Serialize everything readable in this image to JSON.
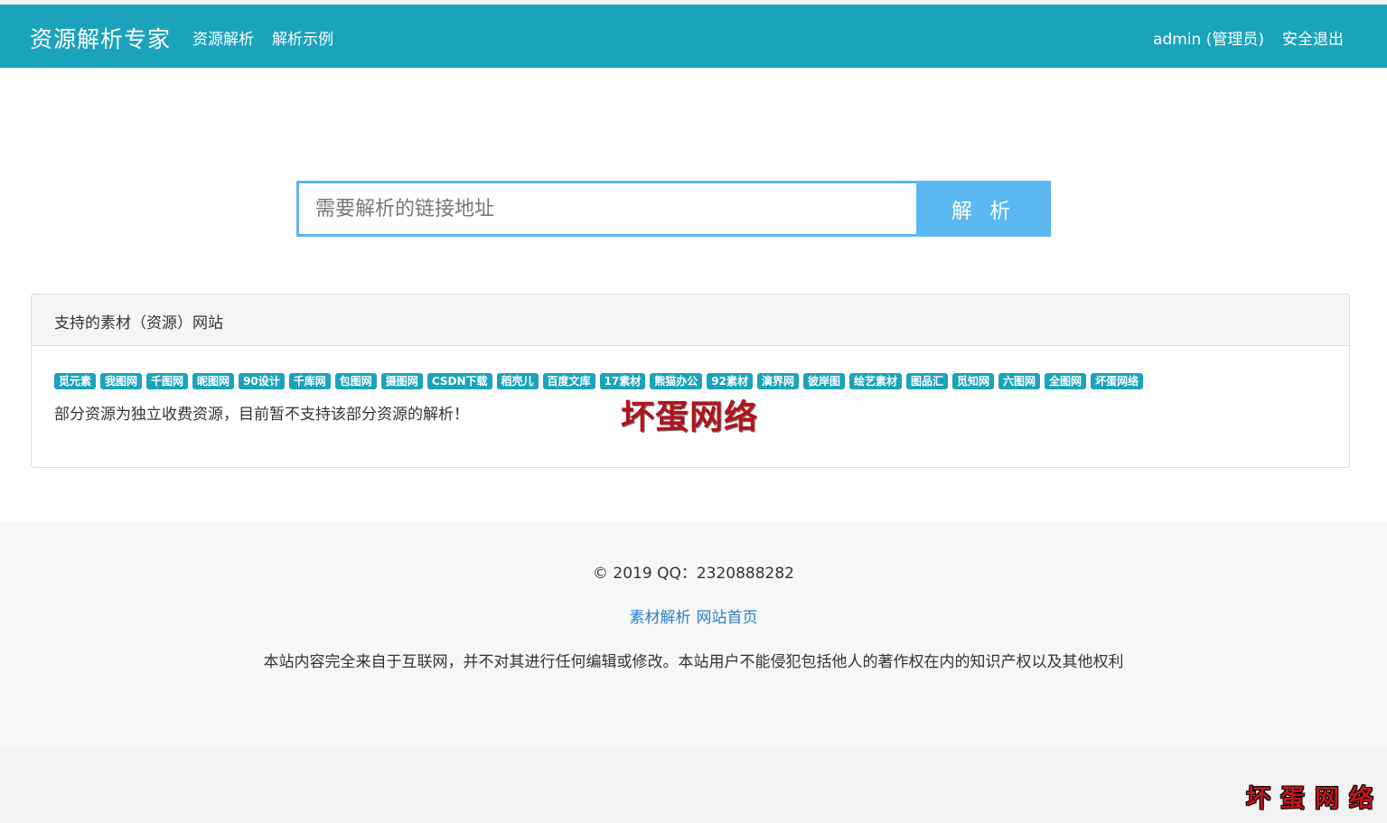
{
  "navbar": {
    "brand": "资源解析专家",
    "left_links": [
      "资源解析",
      "解析示例"
    ],
    "user": "admin (管理员)",
    "logout": "安全退出"
  },
  "search": {
    "placeholder": "需要解析的链接地址",
    "button": "解 析"
  },
  "panel": {
    "title": "支持的素材（资源）网站",
    "tags": [
      "觅元素",
      "我图网",
      "千图网",
      "昵图网",
      "90设计",
      "千库网",
      "包图网",
      "摄图网",
      "CSDN下载",
      "稻壳儿",
      "百度文库",
      "17素材",
      "熊猫办公",
      "92素材",
      "演界网",
      "彼岸图",
      "绘艺素材",
      "图品汇",
      "觅知网",
      "六图网",
      "全图网",
      "坏蛋网络"
    ],
    "note": "部分资源为独立收费资源，目前暂不支持该部分资源的解析！",
    "watermark": "坏蛋网络"
  },
  "footer": {
    "copyright": "© 2019 QQ：2320888282",
    "links": [
      "素材解析",
      "网站首页"
    ],
    "disclaimer": "本站内容完全来自于互联网，并不对其进行任何编辑或修改。本站用户不能侵犯包括他人的著作权在内的知识产权以及其他权利"
  },
  "corner_watermark": "坏蛋网络",
  "colors": {
    "navbar": "#1ba3bb",
    "search_accent": "#5bb8f0",
    "tag": "#1ba3bb",
    "link": "#2a7fc7",
    "watermark": "#b1141e"
  }
}
